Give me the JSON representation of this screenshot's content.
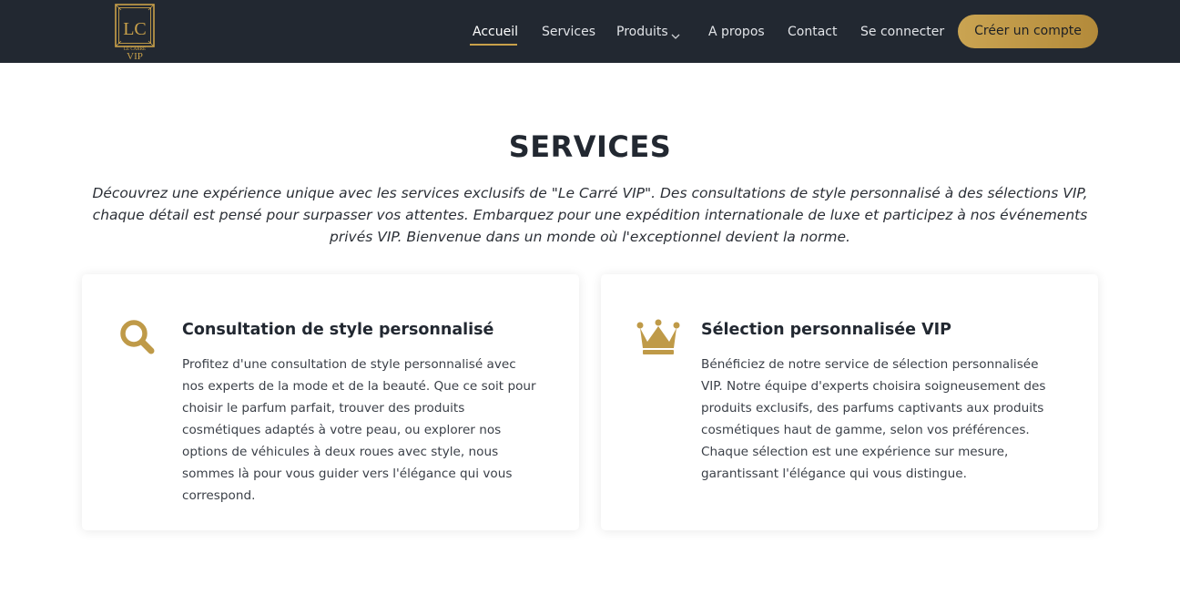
{
  "brand": {
    "logo_initials": "LC",
    "logo_tagline": "LE CARRÉ",
    "logo_suffix": "VIP",
    "accent_color": "#c9a14a",
    "nav_background": "#222831"
  },
  "nav": {
    "items": [
      {
        "label": "Accueil",
        "active": true
      },
      {
        "label": "Services"
      },
      {
        "label": "Produits",
        "icon": "chevron-down-icon"
      },
      {
        "label": "A propos"
      },
      {
        "label": "Contact"
      },
      {
        "label": "Se connecter"
      }
    ],
    "cta_label": "Créer un compte"
  },
  "section": {
    "title": "SERVICES",
    "intro": "Découvrez une expérience unique avec les services exclusifs de \"Le Carré VIP\". Des consultations de style personnalisé à des sélections VIP, chaque détail est pensé pour surpasser vos attentes. Embarquez pour une expédition internationale de luxe et participez à nos événements privés VIP. Bienvenue dans un monde où l'exceptionnel devient la norme."
  },
  "services": [
    {
      "icon": "search-icon",
      "title": "Consultation de style personnalisé",
      "text": "Profitez d'une consultation de style personnalisé avec nos experts de la mode et de la beauté. Que ce soit pour choisir le parfum parfait, trouver des produits cosmétiques adaptés à votre peau, ou explorer nos options de véhicules à deux roues avec style, nous sommes là pour vous guider vers l'élégance qui vous correspond."
    },
    {
      "icon": "crown-icon",
      "title": "Sélection personnalisée VIP",
      "text": "Bénéficiez de notre service de sélection personnalisée VIP. Notre équipe d'experts choisira soigneusement des produits exclusifs, des parfums captivants aux produits cosmétiques haut de gamme, selon vos préférences. Chaque sélection est une expérience sur mesure, garantissant l'élégance qui vous distingue."
    }
  ]
}
